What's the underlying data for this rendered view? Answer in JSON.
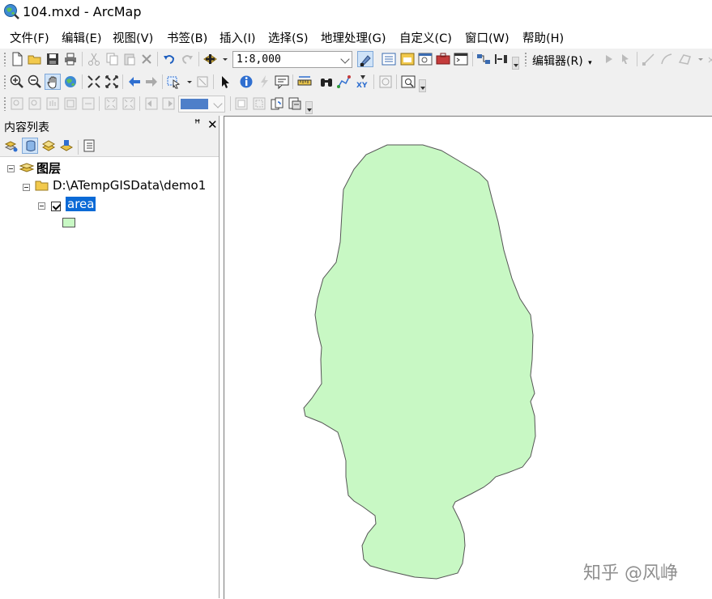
{
  "window": {
    "title": "104.mxd - ArcMap"
  },
  "menu": {
    "items": [
      "文件(F)",
      "编辑(E)",
      "视图(V)",
      "书签(B)",
      "插入(I)",
      "选择(S)",
      "地理处理(G)",
      "自定义(C)",
      "窗口(W)",
      "帮助(H)"
    ]
  },
  "toolbar": {
    "scale_value": "1:8,000",
    "editor_label": "编辑器(R)"
  },
  "toc": {
    "title": "内容列表",
    "pin_glyph": "ꟸ",
    "close_glyph": "✕",
    "root_label": "图层",
    "folder_label": "D:\\ATempGISData\\demo1",
    "layer_label": "area",
    "layer_checked": true
  },
  "map": {
    "fill_color": "#c8f8c4",
    "stroke_color": "#555555"
  },
  "watermark": "知乎 @风峥"
}
